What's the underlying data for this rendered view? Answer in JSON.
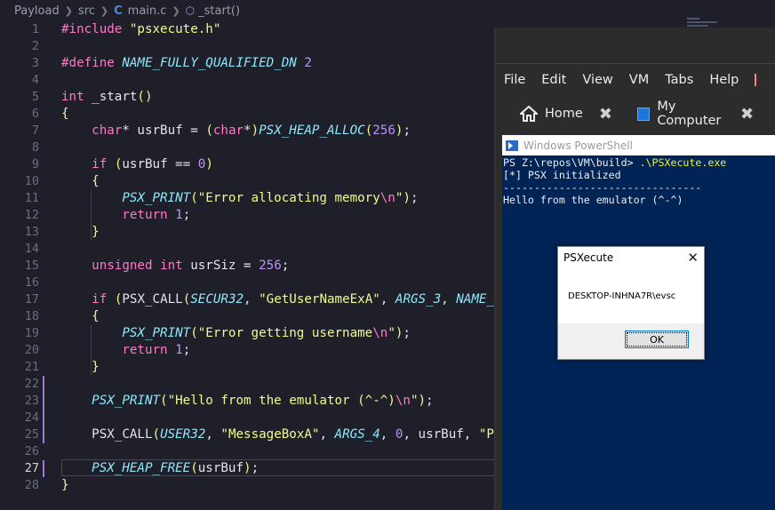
{
  "breadcrumb": {
    "items": [
      "Payload",
      "src",
      "main.c",
      "_start()"
    ]
  },
  "editor": {
    "lines": [
      {
        "n": "1"
      },
      {
        "n": "2"
      },
      {
        "n": "3"
      },
      {
        "n": "4"
      },
      {
        "n": "5"
      },
      {
        "n": "6"
      },
      {
        "n": "7"
      },
      {
        "n": "8"
      },
      {
        "n": "9"
      },
      {
        "n": "10"
      },
      {
        "n": "11"
      },
      {
        "n": "12"
      },
      {
        "n": "13"
      },
      {
        "n": "14"
      },
      {
        "n": "15"
      },
      {
        "n": "16"
      },
      {
        "n": "17"
      },
      {
        "n": "18"
      },
      {
        "n": "19"
      },
      {
        "n": "20"
      },
      {
        "n": "21"
      },
      {
        "n": "22"
      },
      {
        "n": "23"
      },
      {
        "n": "24"
      },
      {
        "n": "25"
      },
      {
        "n": "26"
      },
      {
        "n": "27"
      },
      {
        "n": "28"
      }
    ],
    "active_line": "27",
    "code": {
      "l1_directive": "#include",
      "l1_file": "\"psxecute.h\"",
      "l3_directive": "#define",
      "l3_name": "NAME_FULLY_QUALIFIED_DN",
      "l3_value": "2",
      "l5_type": "int",
      "l5_name": "_start",
      "l6": "{",
      "l7_type": "char",
      "l7_decl": "* usrBuf = ",
      "l7_cast": "char",
      "l7_macro": "PSX_HEAP_ALLOC",
      "l7_size": "256",
      "l9_kw": "if",
      "l9_cond": "usrBuf == ",
      "l9_zero": "0",
      "l10": "{",
      "l11_macro": "PSX_PRINT",
      "l11_str": "\"Error allocating memory",
      "l11_esc": "\\n",
      "l12_kw": "return",
      "l12_val": "1",
      "l13": "}",
      "l15_kw1": "unsigned",
      "l15_kw2": "int",
      "l15_decl": " usrSiz = ",
      "l15_val": "256",
      "l17_kw": "if",
      "l17_macro": "PSX_CALL",
      "l17_arg1": "SECUR32",
      "l17_str": "\"GetUserNameExA\"",
      "l17_arg3": "ARGS_3",
      "l17_arg4": "NAME_F",
      "l18": "{",
      "l19_macro": "PSX_PRINT",
      "l19_str": "\"Error getting username",
      "l19_esc": "\\n",
      "l20_kw": "return",
      "l20_val": "1",
      "l21": "}",
      "l23_macro": "PSX_PRINT",
      "l23_str": "\"Hello from the emulator (^-^)",
      "l23_esc": "\\n",
      "l25_macro": "PSX_CALL",
      "l25_arg1": "USER32",
      "l25_str": "\"MessageBoxA\"",
      "l25_arg3": "ARGS_4",
      "l25_zero": "0",
      "l25_rest": "usrBuf, ",
      "l25_tail": "\"PS",
      "l27_macro": "PSX_HEAP_FREE",
      "l27_arg": "usrBuf",
      "l28": "}"
    }
  },
  "vm": {
    "menu": [
      "File",
      "Edit",
      "View",
      "VM",
      "Tabs",
      "Help"
    ],
    "tabs": [
      {
        "label": "Home"
      },
      {
        "label": "My Computer"
      }
    ]
  },
  "powershell": {
    "title": "Windows PowerShell",
    "prompt": "PS Z:\\repos\\VM\\build> ",
    "command": ".\\PSXecute.exe",
    "line2": "[*] PSX initialized",
    "line3": "--------------------------------",
    "line4": "Hello from the emulator (^-^)"
  },
  "dialog": {
    "title": "PSXecute",
    "message": "DESKTOP-INHNA7R\\evsc",
    "ok_label": "OK"
  },
  "colors": {
    "editor_bg": "#1e1f29",
    "keyword": "#ff79c6",
    "string": "#f1fa8c",
    "number": "#bd93f9",
    "macro": "#8be9fd",
    "powershell_bg": "#012456"
  }
}
